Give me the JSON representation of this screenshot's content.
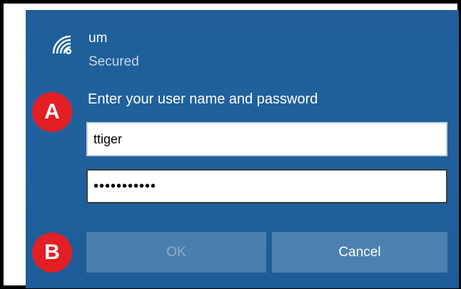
{
  "network": {
    "icon": "wifi-secured-icon",
    "name": "um",
    "status": "Secured"
  },
  "login": {
    "prompt": "Enter your user name and password",
    "username_value": "ttiger",
    "password_value": "•••••••••••"
  },
  "buttons": {
    "ok_label": "OK",
    "cancel_label": "Cancel"
  },
  "annotations": {
    "marker_a": "A",
    "marker_b": "B"
  },
  "colors": {
    "panel_background": "#20619d",
    "button_background": "#4c80b0",
    "marker_red": "#e31e25"
  }
}
